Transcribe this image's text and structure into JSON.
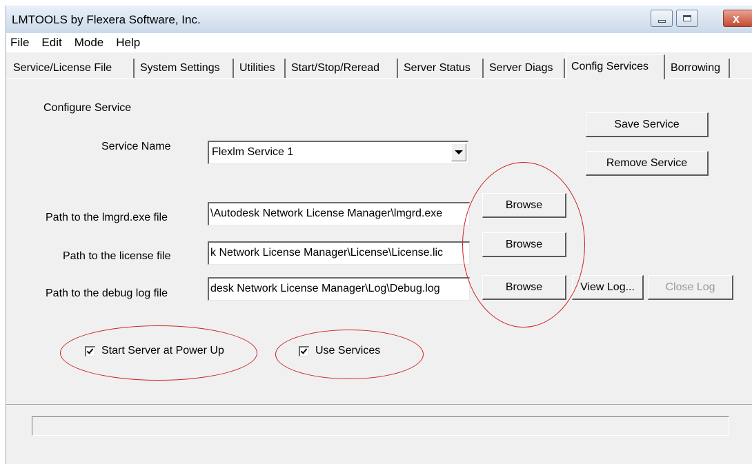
{
  "window": {
    "title": "LMTOOLS by Flexera Software, Inc.",
    "close_glyph": "x"
  },
  "menu": [
    "File",
    "Edit",
    "Mode",
    "Help"
  ],
  "tabs": [
    {
      "label": "Service/License File"
    },
    {
      "label": "System Settings"
    },
    {
      "label": "Utilities"
    },
    {
      "label": "Start/Stop/Reread"
    },
    {
      "label": "Server Status"
    },
    {
      "label": "Server Diags"
    },
    {
      "label": "Config Services",
      "active": true
    },
    {
      "label": "Borrowing"
    }
  ],
  "config": {
    "section_label": "Configure Service",
    "service_name_label": "Service Name",
    "service_name_value": "Flexlm Service 1",
    "save_service": "Save Service",
    "remove_service": "Remove Service",
    "lmgrd_label": "Path to the lmgrd.exe file",
    "lmgrd_value": "\\Autodesk Network License Manager\\lmgrd.exe",
    "license_label": "Path to the license file",
    "license_value": "k Network License Manager\\License\\License.lic",
    "debug_label": "Path to the debug log file",
    "debug_value": "desk Network License Manager\\Log\\Debug.log",
    "browse": "Browse",
    "view_log": "View Log...",
    "close_log": "Close Log",
    "start_at_power_up": "Start Server at Power Up",
    "start_at_power_up_checked": true,
    "use_services": "Use Services",
    "use_services_checked": true
  },
  "status_bar": {
    "text": ""
  },
  "colors": {
    "annotation_ellipse": "#cc2020",
    "window_bg": "#f0f0f0"
  }
}
